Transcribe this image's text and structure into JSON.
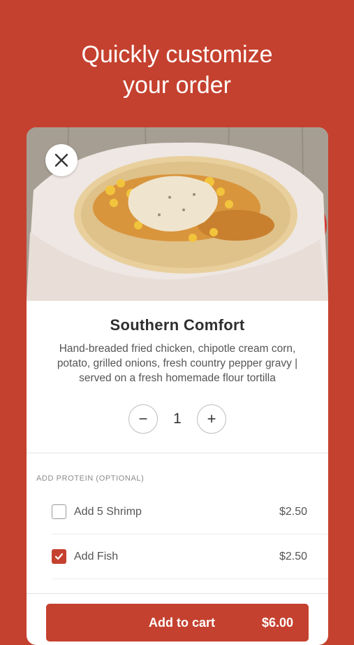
{
  "headline": {
    "line1": "Quickly customize",
    "line2": "your order"
  },
  "item": {
    "name": "Southern Comfort",
    "description": "Hand-breaded fried chicken, chipotle cream corn, potato, grilled onions, fresh country pepper gravy | served on a fresh homemade flour tortilla",
    "quantity": "1",
    "minus_label": "−",
    "plus_label": "+"
  },
  "protein_section": {
    "label": "ADD PROTEIN (OPTIONAL)",
    "options": [
      {
        "name": "Add 5 Shrimp",
        "price": "$2.50",
        "checked": false
      },
      {
        "name": "Add Fish",
        "price": "$2.50",
        "checked": true
      }
    ]
  },
  "cart": {
    "label": "Add to cart",
    "total": "$6.00"
  },
  "colors": {
    "brand": "#c5412f",
    "background": "#c5412f"
  },
  "icons": {
    "close": "close-icon",
    "check": "check-icon"
  }
}
